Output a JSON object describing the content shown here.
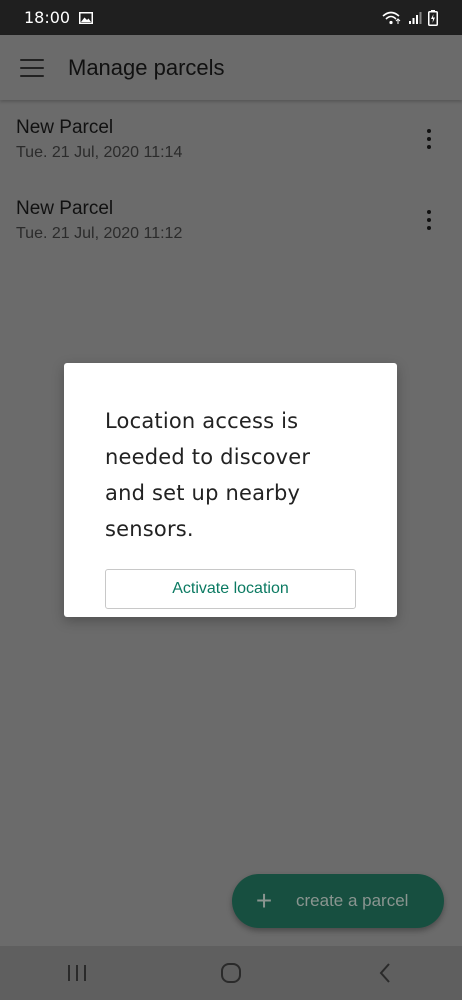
{
  "status_bar": {
    "time": "18:00",
    "icons": [
      "image-icon",
      "wifi-icon",
      "signal-icon",
      "battery-icon"
    ]
  },
  "app_bar": {
    "title": "Manage parcels",
    "menu_icon": "hamburger-menu-icon"
  },
  "parcels": [
    {
      "name": "New Parcel",
      "date": "Tue. 21 Jul, 2020 11:14"
    },
    {
      "name": "New Parcel",
      "date": "Tue. 21 Jul, 2020 11:12"
    }
  ],
  "dialog": {
    "message": "Location access is needed to discover and set up nearby sensors.",
    "button_label": "Activate location"
  },
  "fab": {
    "icon": "plus-icon",
    "label": "create a parcel"
  },
  "nav_bar": {
    "buttons": [
      "recents-icon",
      "home-icon",
      "back-icon"
    ]
  },
  "colors": {
    "accent": "#0b7a62",
    "fab_background": "#174f40",
    "scrim_background": "#6b6b6b"
  }
}
